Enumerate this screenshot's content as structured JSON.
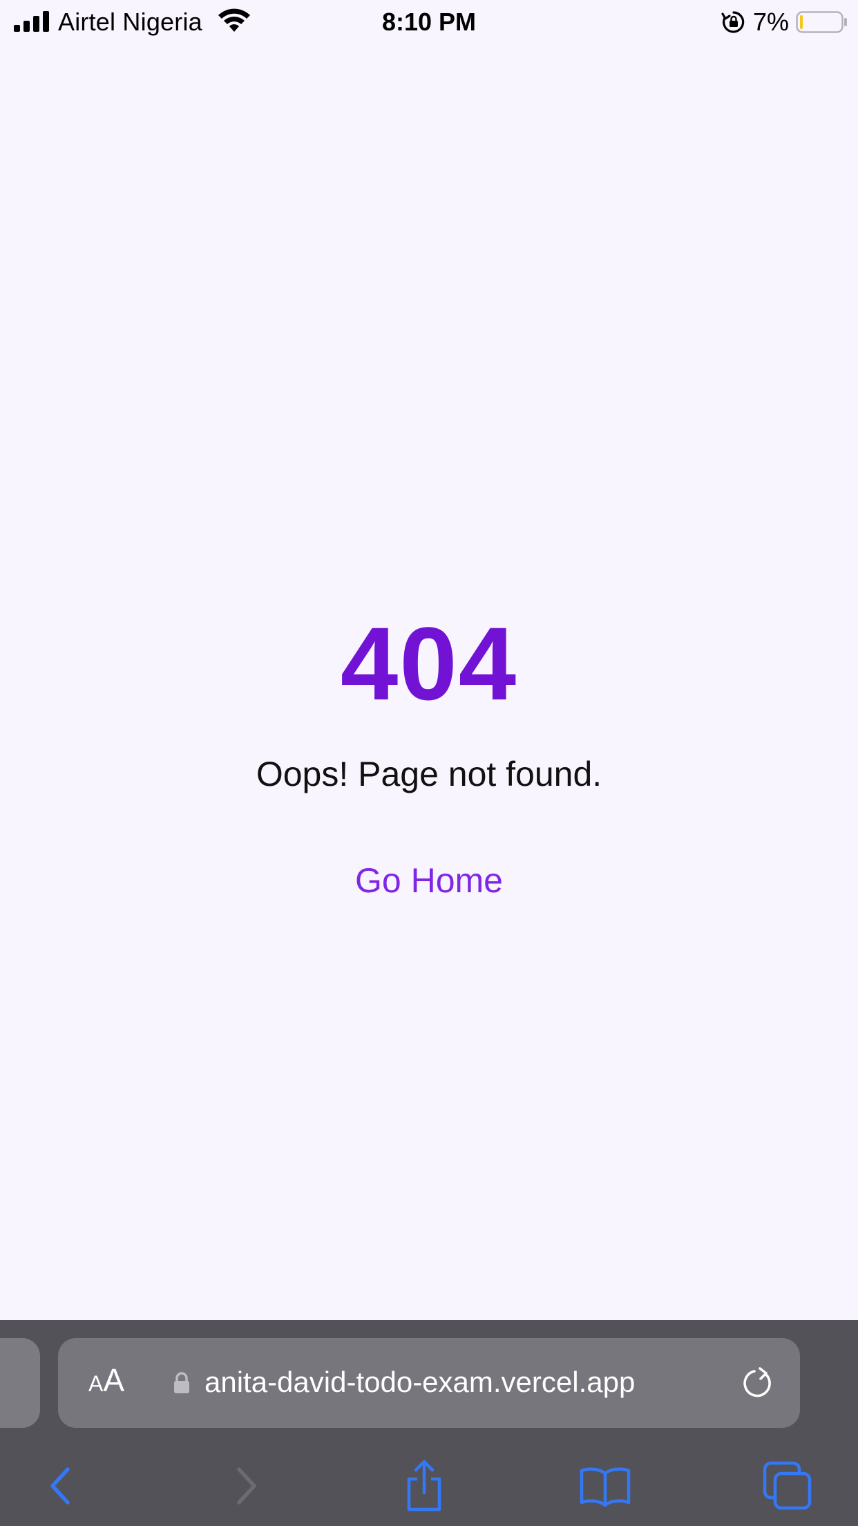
{
  "status_bar": {
    "carrier": "Airtel Nigeria",
    "time": "8:10 PM",
    "battery_percent": "7%",
    "battery_level": 0.07,
    "icons": [
      "signal-icon",
      "wifi-icon",
      "rotation-lock-icon",
      "battery-icon"
    ]
  },
  "page": {
    "error_code": "404",
    "message": "Oops! Page not found.",
    "home_link": "Go Home"
  },
  "browser": {
    "text_size_small": "A",
    "text_size_large": "A",
    "url": "anita-david-todo-exam.vercel.app",
    "icons": [
      "lock-icon",
      "reload-icon",
      "back-icon",
      "forward-icon",
      "share-icon",
      "bookmarks-icon",
      "tabs-icon"
    ]
  },
  "colors": {
    "background": "#f8f5fe",
    "accent_heading": "#7112d4",
    "accent_link": "#8126e3",
    "toolbar_bg": "#535259",
    "toolbar_icon": "#3478f6"
  }
}
